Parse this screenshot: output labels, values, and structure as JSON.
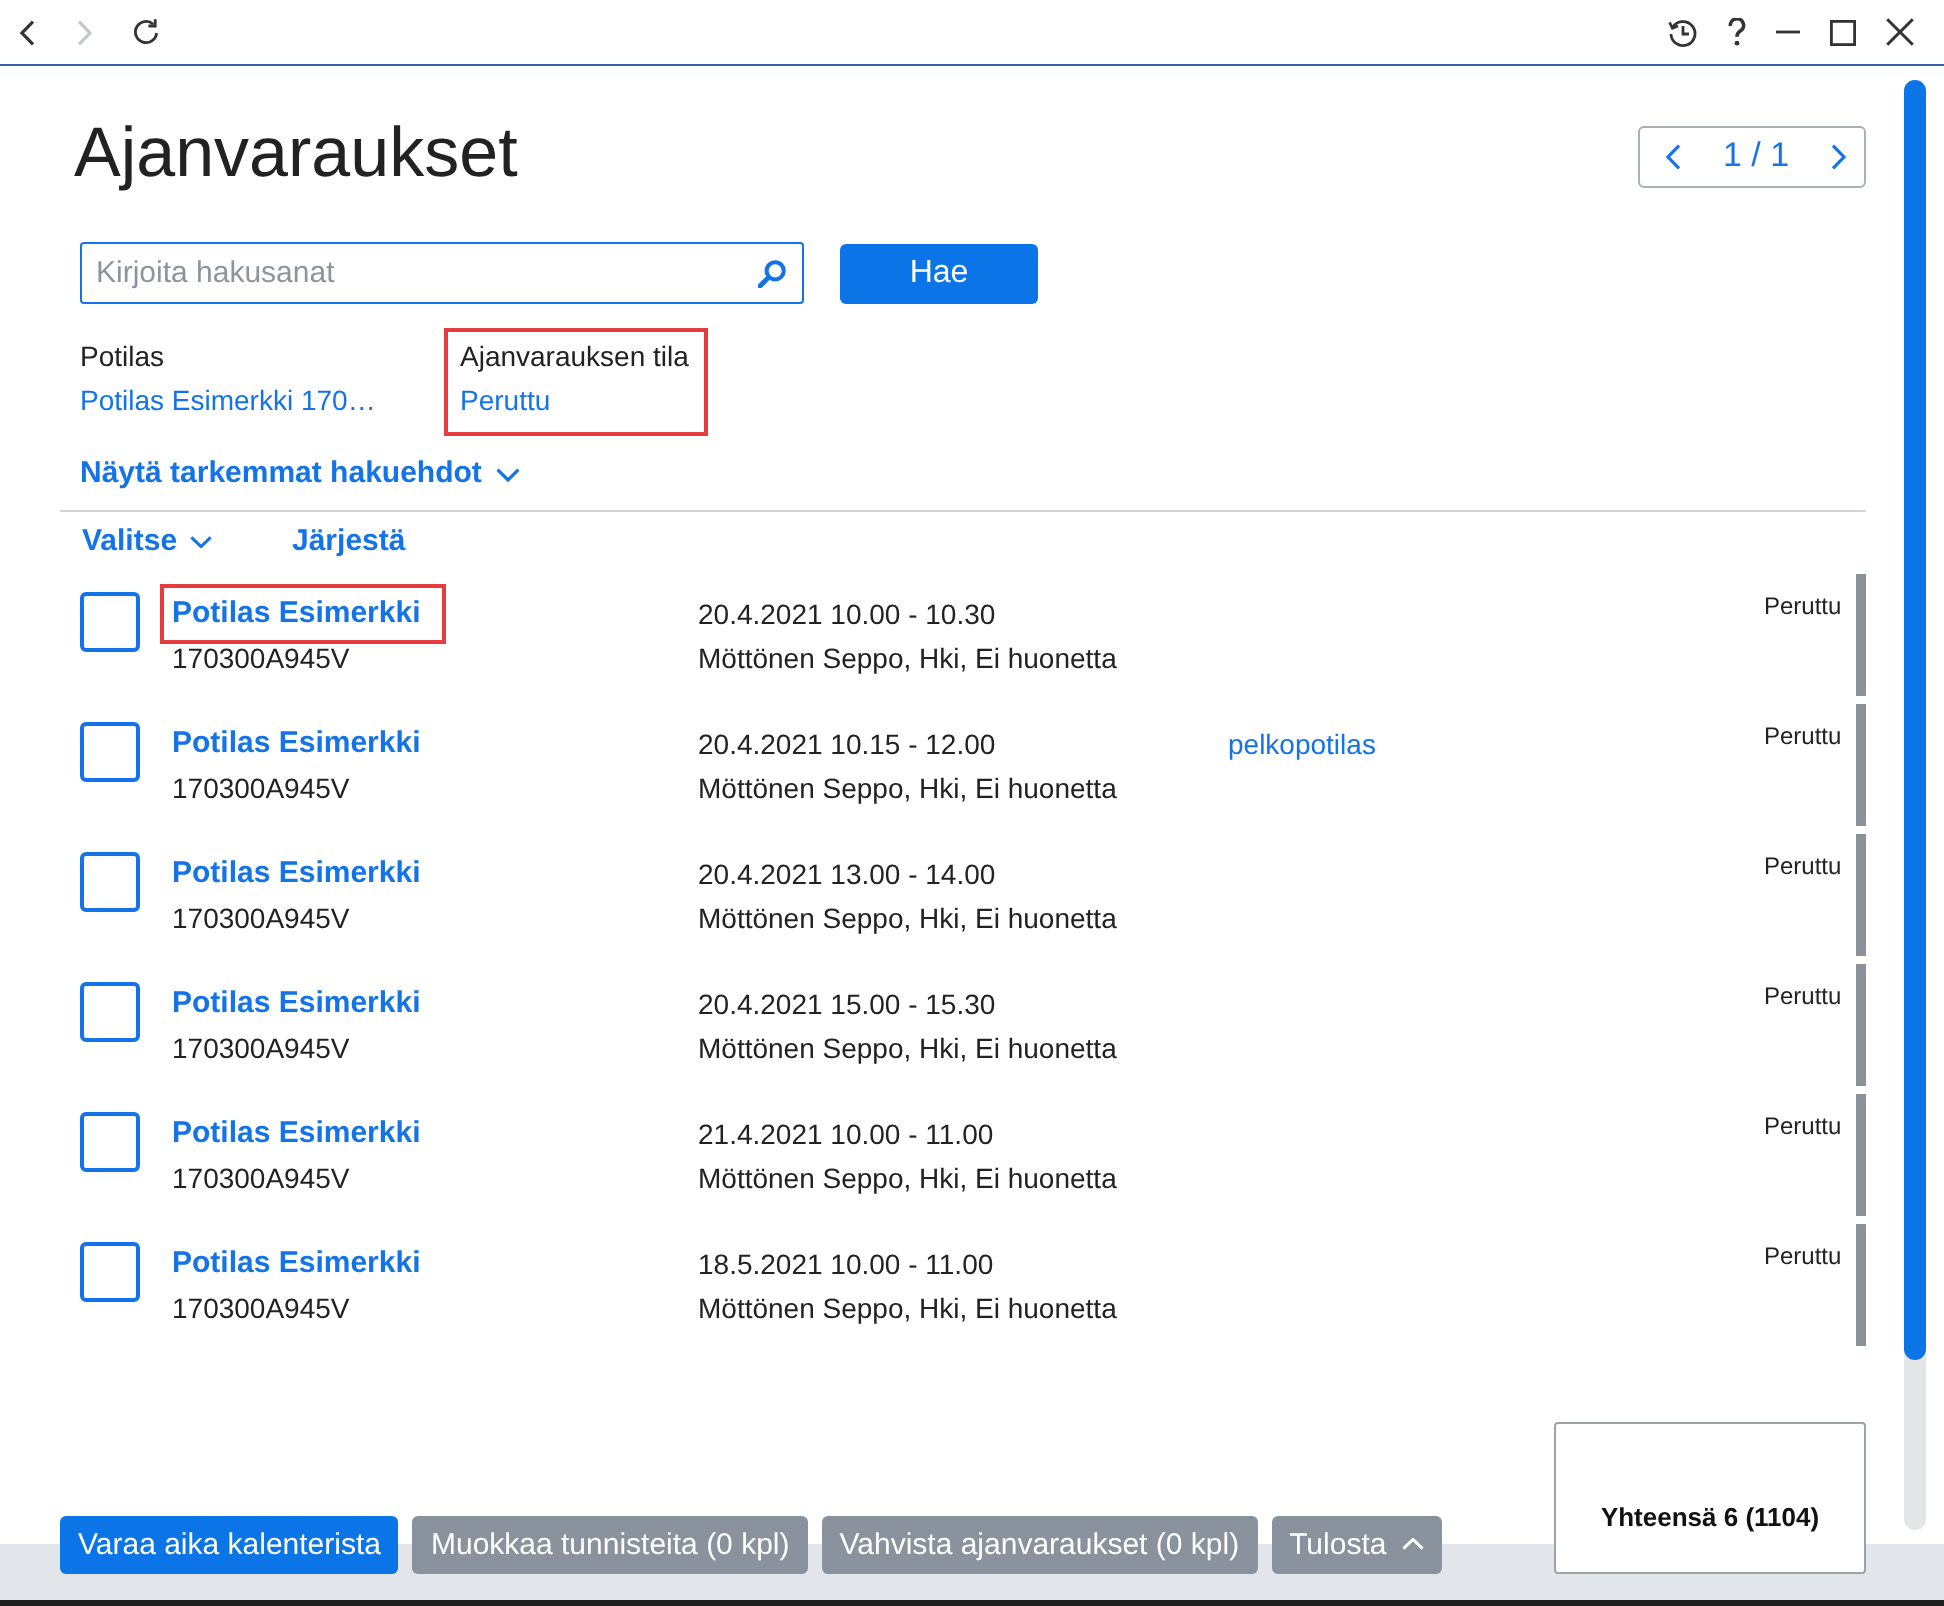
{
  "toolbar": {
    "nav": [
      {
        "kind": "back",
        "disabled": false
      },
      {
        "kind": "forward",
        "disabled": true
      },
      {
        "kind": "refresh",
        "disabled": false
      }
    ],
    "window_controls": [
      {
        "kind": "history"
      },
      {
        "kind": "help"
      },
      {
        "kind": "minimize"
      },
      {
        "kind": "maximize"
      },
      {
        "kind": "close"
      }
    ]
  },
  "page": {
    "title": "Ajanvaraukset",
    "pager": "1 / 1"
  },
  "search": {
    "placeholder": "Kirjoita hakusanat",
    "button": "Hae"
  },
  "filters": [
    {
      "label": "Potilas",
      "value": "Potilas Esimerkki 170…",
      "highlighted": false
    },
    {
      "label": "Ajanvarauksen tila",
      "value": "Peruttu",
      "highlighted": true
    }
  ],
  "more_filters": "Näytä tarkemmat hakuehdot",
  "list_actions": {
    "select": "Valitse",
    "sort": "Järjestä"
  },
  "appointments": [
    {
      "checked": false,
      "patient": "Potilas Esimerkki",
      "highlighted": true,
      "patient_id": "170300A945V",
      "time": "20.4.2021 10.00 - 10.30",
      "details": "Möttönen Seppo, Hki, Ei huonetta",
      "status": "Peruttu",
      "color": "#8c9299"
    },
    {
      "checked": false,
      "patient": "Potilas Esimerkki",
      "highlighted": false,
      "patient_id": "170300A945V",
      "time": "20.4.2021 10.15 - 12.00",
      "details": "Möttönen Seppo, Hki, Ei huonetta",
      "tag": "pelkopotilas",
      "status": "Peruttu",
      "color": "#8c9299"
    },
    {
      "checked": false,
      "patient": "Potilas Esimerkki",
      "highlighted": false,
      "patient_id": "170300A945V",
      "time": "20.4.2021 13.00 - 14.00",
      "details": "Möttönen Seppo, Hki, Ei huonetta",
      "status": "Peruttu",
      "color": "#8c9299"
    },
    {
      "checked": false,
      "patient": "Potilas Esimerkki",
      "highlighted": false,
      "patient_id": "170300A945V",
      "time": "20.4.2021 15.00 - 15.30",
      "details": "Möttönen Seppo, Hki, Ei huonetta",
      "status": "Peruttu",
      "color": "#8c9299"
    },
    {
      "checked": false,
      "patient": "Potilas Esimerkki",
      "highlighted": false,
      "patient_id": "170300A945V",
      "time": "21.4.2021 10.00 - 11.00",
      "details": "Möttönen Seppo, Hki, Ei huonetta",
      "status": "Peruttu",
      "color": "#8c9299"
    },
    {
      "checked": false,
      "patient": "Potilas Esimerkki",
      "highlighted": false,
      "patient_id": "170300A945V",
      "time": "18.5.2021 10.00 - 11.00",
      "details": "Möttönen Seppo, Hki, Ei huonetta",
      "status": "Peruttu",
      "color": "#8c9299"
    }
  ],
  "footer": {
    "buttons": [
      {
        "label": "Varaa aika kalenterista",
        "kind": "plain",
        "disabled": false
      },
      {
        "label": "Muokkaa tunnisteita (0 kpl)",
        "kind": "plain",
        "disabled": true
      },
      {
        "label": "Vahvista ajanvaraukset (0 kpl)",
        "kind": "plain",
        "disabled": true
      },
      {
        "label": "Tulosta",
        "kind": "menu",
        "disabled": true
      }
    ],
    "total": "Yhteensä 6 (1104)"
  }
}
